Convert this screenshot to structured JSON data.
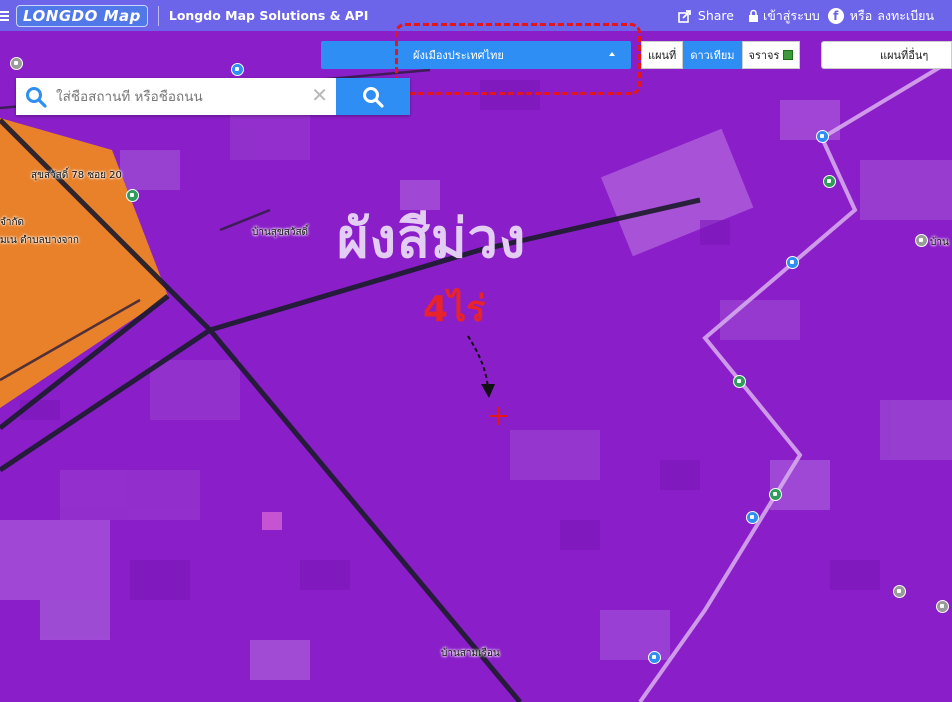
{
  "topbar": {
    "logo": "LONGDO Map",
    "brand": "Longdo Map Solutions & API",
    "share_label": "Share",
    "login_label": "เข้าสู่ระบบ",
    "or_label": "หรือ",
    "register_label": "ลงทะเบียน",
    "bg_color": "#6c64e9"
  },
  "layers": {
    "selected_layer": "ผังเมืองประเทศไทย",
    "base_tabs": [
      {
        "label": "แผนที่",
        "active": false
      },
      {
        "label": "ดาวเทียม",
        "active": true
      },
      {
        "label": "จราจร",
        "active": false
      }
    ],
    "other_maps_label": "แผนที่อื่นๆ",
    "accent_color": "#2f8ef3",
    "highlight_color": "#e3161c"
  },
  "search": {
    "placeholder": "ใส่ชื่อสถานที่ หรือชื่อถนน",
    "value": ""
  },
  "annotations": {
    "zone_title": "ผังสีม่วง",
    "area": "4ไร่",
    "zone_color": "#8a1fc9",
    "marker_color": "#e3161c"
  },
  "place_labels": {
    "soi": "สุขสวัสดิ์ 78 ซอย 20",
    "company_1": "จำกัด",
    "company_2": "มเน ตำบลบางจาก",
    "village_1": "บ้านสุขสวัสดิ์",
    "village_2": "บ้านสามเรือน",
    "right_edge": "บ้าน"
  },
  "icons": [
    "menu-icon",
    "share-icon",
    "lock-icon",
    "facebook-icon",
    "search-icon",
    "clear-icon",
    "bus-stop-icon",
    "shop-icon",
    "school-icon"
  ]
}
